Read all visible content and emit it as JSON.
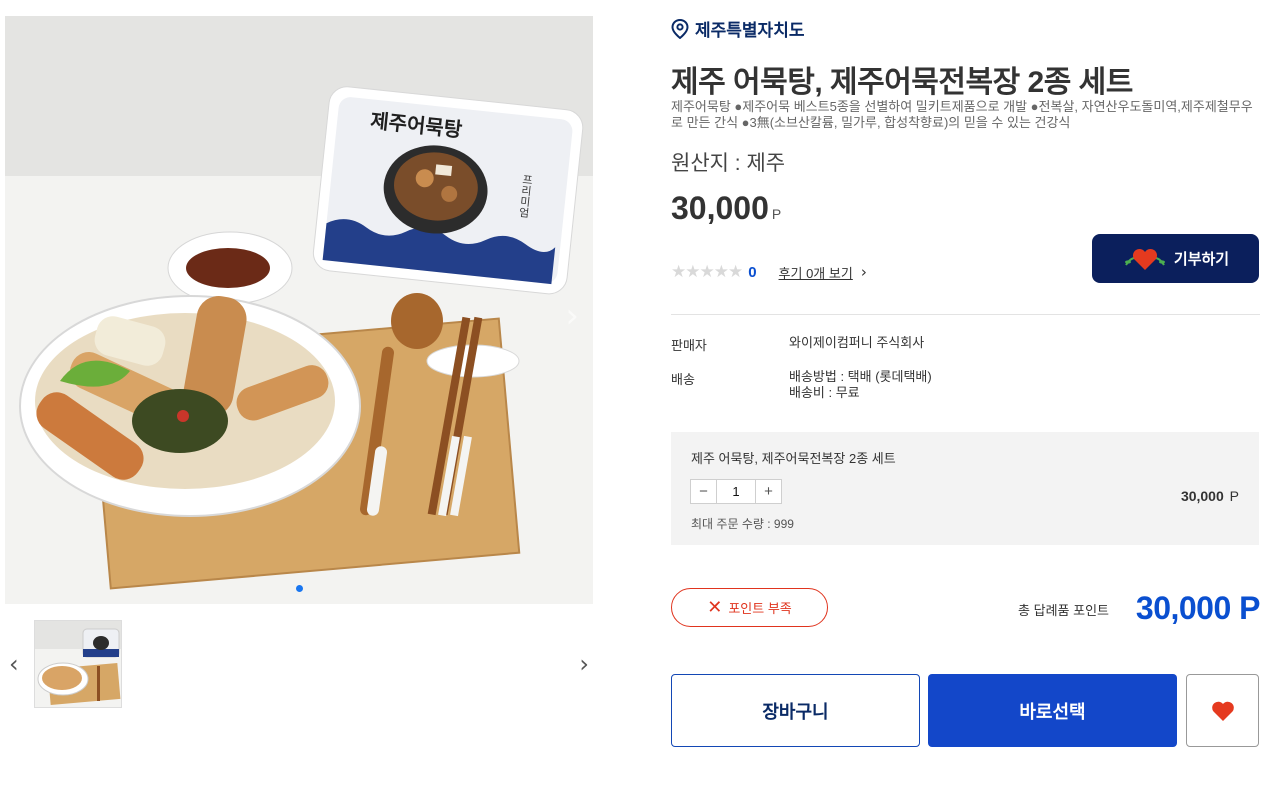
{
  "region": {
    "label": "제주특별자치도",
    "icon": "location-pin-icon"
  },
  "product": {
    "title": "제주 어묵탕, 제주어묵전복장 2종 세트",
    "description": "제주어묵탕 ●제주어묵 베스트5종을 선별하여 밀키트제품으로 개발 ●전복살, 자연산우도돌미역,제주제철무우로 만든 간식 ●3無(소브산칼륨, 밀가루, 합성착향료)의 믿을 수 있는 건강식",
    "origin": "원산지 : 제주",
    "price": "30,000",
    "price_unit": "P",
    "image_package_text": "제주어묵탕"
  },
  "rating": {
    "stars": 0,
    "count": "0",
    "review_link": "후기 0개 보기"
  },
  "donate": {
    "label": "기부하기",
    "color": "#0b1f5c"
  },
  "specs": {
    "seller_label": "판매자",
    "seller_value": "와이제이컴퍼니 주식회사",
    "shipping_label": "배송",
    "shipping_method": "배송방법 : 택배 (롯데택배)",
    "shipping_fee": "배송비 : 무료"
  },
  "option": {
    "title": "제주 어묵탕, 제주어묵전복장 2종 세트",
    "quantity": "1",
    "minus": "−",
    "plus": "+",
    "price": "30,000",
    "price_unit": "P",
    "max_qty": "최대 주문 수량 : 999"
  },
  "points": {
    "warning": "포인트 부족",
    "total_label": "총 답례품 포인트",
    "total_value": "30,000 P"
  },
  "actions": {
    "cart": "장바구니",
    "buy": "바로선택"
  },
  "colors": {
    "accent": "#1347c9",
    "navy": "#0a2a66",
    "warning": "#e0341e",
    "heart": "#e53a1f"
  }
}
